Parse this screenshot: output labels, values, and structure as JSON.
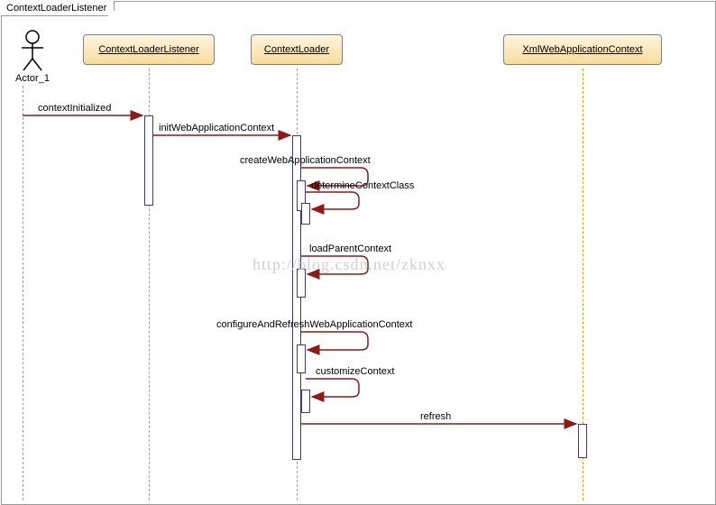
{
  "diagram": {
    "title": "ContextLoaderListener",
    "actor": {
      "name": "Actor_1"
    },
    "participants": {
      "p1": "ContextLoaderListener",
      "p2": "ContextLoader",
      "p3": "XmlWebApplicationContext"
    },
    "messages": {
      "m1": "contextInitialized",
      "m2": "initWebApplicationContext",
      "m3": "createWebApplicationContext",
      "m4": "determineContextClass",
      "m5": "loadParentContext",
      "m6": "configureAndRefreshWebApplicationContext",
      "m7": "customizeContext",
      "m8": "refresh"
    },
    "watermark": "http://blog.csdn.net/zknxx"
  },
  "chart_data": {
    "type": "sequence_diagram",
    "frame": "ContextLoaderListener",
    "lifelines": [
      {
        "id": "actor",
        "name": "Actor_1",
        "kind": "actor"
      },
      {
        "id": "cll",
        "name": "ContextLoaderListener",
        "kind": "object"
      },
      {
        "id": "cl",
        "name": "ContextLoader",
        "kind": "object"
      },
      {
        "id": "xwac",
        "name": "XmlWebApplicationContext",
        "kind": "object"
      }
    ],
    "messages": [
      {
        "from": "actor",
        "to": "cll",
        "label": "contextInitialized",
        "type": "sync"
      },
      {
        "from": "cll",
        "to": "cl",
        "label": "initWebApplicationContext",
        "type": "sync"
      },
      {
        "from": "cl",
        "to": "cl",
        "label": "createWebApplicationContext",
        "type": "self"
      },
      {
        "from": "cl",
        "to": "cl",
        "label": "determineContextClass",
        "type": "self"
      },
      {
        "from": "cl",
        "to": "cl",
        "label": "loadParentContext",
        "type": "self"
      },
      {
        "from": "cl",
        "to": "cl",
        "label": "configureAndRefreshWebApplicationContext",
        "type": "self"
      },
      {
        "from": "cl",
        "to": "cl",
        "label": "customizeContext",
        "type": "self"
      },
      {
        "from": "cl",
        "to": "xwac",
        "label": "refresh",
        "type": "sync"
      }
    ]
  }
}
